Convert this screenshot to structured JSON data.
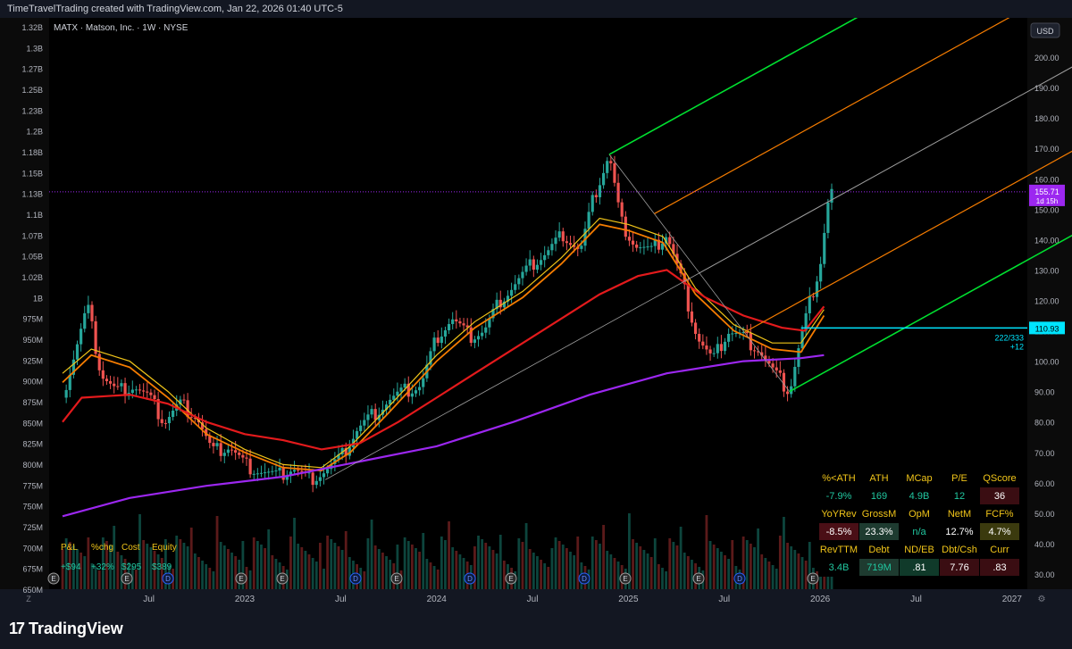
{
  "header": {
    "attribution": "TimeTravelTrading created with TradingView.com, Jan 22, 2026 01:40 UTC-5"
  },
  "footer": {
    "brand": "TradingView",
    "logo_glyph": "17"
  },
  "chart_data": {
    "type": "candlestick",
    "symbol_label": "MATX · Matson, Inc. · 1W · NYSE",
    "currency_button": "USD",
    "price_axis": {
      "range": [
        25,
        210
      ],
      "ticks": [
        "200.00",
        "190.00",
        "180.00",
        "170.00",
        "160.00",
        "150.00",
        "140.00",
        "130.00",
        "120.00",
        "110.00",
        "100.00",
        "90.00",
        "80.00",
        "70.00",
        "60.00",
        "50.00",
        "40.00",
        "30.00"
      ]
    },
    "left_axis": {
      "ticks": [
        "1.32B",
        "1.3B",
        "1.27B",
        "1.25B",
        "1.23B",
        "1.2B",
        "1.18B",
        "1.15B",
        "1.13B",
        "1.1B",
        "1.07B",
        "1.05B",
        "1.02B",
        "1B",
        "975M",
        "950M",
        "925M",
        "900M",
        "875M",
        "850M",
        "825M",
        "800M",
        "775M",
        "750M",
        "725M",
        "700M",
        "675M",
        "650M"
      ]
    },
    "time_axis": {
      "ticks": [
        {
          "label": "Jul",
          "t": 2022.5
        },
        {
          "label": "2023",
          "t": 2023.0
        },
        {
          "label": "Jul",
          "t": 2023.5
        },
        {
          "label": "2024",
          "t": 2024.0
        },
        {
          "label": "Jul",
          "t": 2024.5
        },
        {
          "label": "2025",
          "t": 2025.0
        },
        {
          "label": "Jul",
          "t": 2025.5
        },
        {
          "label": "2026",
          "t": 2026.0
        },
        {
          "label": "Jul",
          "t": 2026.5
        },
        {
          "label": "2027",
          "t": 2027.0
        }
      ]
    },
    "last_price": {
      "value": 155.71,
      "label": "155.71",
      "countdown": "1d 15h",
      "color": "#9c27f0"
    },
    "horizontal_level": {
      "value": 110.93,
      "label": "110.93",
      "note": "222/333",
      "note2": "+12",
      "color": "#00e5ff"
    },
    "price_path": [
      {
        "t": 2022.05,
        "p": 88
      },
      {
        "t": 2022.12,
        "p": 104
      },
      {
        "t": 2022.18,
        "p": 118
      },
      {
        "t": 2022.25,
        "p": 96
      },
      {
        "t": 2022.33,
        "p": 90
      },
      {
        "t": 2022.42,
        "p": 92
      },
      {
        "t": 2022.5,
        "p": 88
      },
      {
        "t": 2022.58,
        "p": 80
      },
      {
        "t": 2022.66,
        "p": 86
      },
      {
        "t": 2022.75,
        "p": 82
      },
      {
        "t": 2022.83,
        "p": 70
      },
      {
        "t": 2022.92,
        "p": 72
      },
      {
        "t": 2023.0,
        "p": 66
      },
      {
        "t": 2023.08,
        "p": 64
      },
      {
        "t": 2023.17,
        "p": 62
      },
      {
        "t": 2023.25,
        "p": 65
      },
      {
        "t": 2023.33,
        "p": 61
      },
      {
        "t": 2023.42,
        "p": 64
      },
      {
        "t": 2023.5,
        "p": 68
      },
      {
        "t": 2023.58,
        "p": 77
      },
      {
        "t": 2023.66,
        "p": 82
      },
      {
        "t": 2023.75,
        "p": 87
      },
      {
        "t": 2023.83,
        "p": 90
      },
      {
        "t": 2023.92,
        "p": 92
      },
      {
        "t": 2024.0,
        "p": 108
      },
      {
        "t": 2024.08,
        "p": 114
      },
      {
        "t": 2024.17,
        "p": 108
      },
      {
        "t": 2024.25,
        "p": 110
      },
      {
        "t": 2024.33,
        "p": 120
      },
      {
        "t": 2024.42,
        "p": 126
      },
      {
        "t": 2024.5,
        "p": 132
      },
      {
        "t": 2024.58,
        "p": 136
      },
      {
        "t": 2024.66,
        "p": 142
      },
      {
        "t": 2024.75,
        "p": 136
      },
      {
        "t": 2024.82,
        "p": 154
      },
      {
        "t": 2024.9,
        "p": 168
      },
      {
        "t": 2024.96,
        "p": 146
      },
      {
        "t": 2025.04,
        "p": 138
      },
      {
        "t": 2025.12,
        "p": 136
      },
      {
        "t": 2025.2,
        "p": 142
      },
      {
        "t": 2025.28,
        "p": 126
      },
      {
        "t": 2025.36,
        "p": 108
      },
      {
        "t": 2025.44,
        "p": 100
      },
      {
        "t": 2025.52,
        "p": 110
      },
      {
        "t": 2025.6,
        "p": 108
      },
      {
        "t": 2025.68,
        "p": 104
      },
      {
        "t": 2025.76,
        "p": 96
      },
      {
        "t": 2025.84,
        "p": 90
      },
      {
        "t": 2025.88,
        "p": 102
      },
      {
        "t": 2025.94,
        "p": 118
      },
      {
        "t": 2026.0,
        "p": 132
      },
      {
        "t": 2026.04,
        "p": 152
      },
      {
        "t": 2026.06,
        "p": 156
      }
    ],
    "moving_averages": [
      {
        "color": "#f57c00",
        "width": 1.8,
        "points": [
          {
            "t": 2022.05,
            "p": 93
          },
          {
            "t": 2022.2,
            "p": 102
          },
          {
            "t": 2022.4,
            "p": 98
          },
          {
            "t": 2022.6,
            "p": 88
          },
          {
            "t": 2022.8,
            "p": 76
          },
          {
            "t": 2023.0,
            "p": 70
          },
          {
            "t": 2023.2,
            "p": 65
          },
          {
            "t": 2023.4,
            "p": 64
          },
          {
            "t": 2023.55,
            "p": 70
          },
          {
            "t": 2023.75,
            "p": 83
          },
          {
            "t": 2024.0,
            "p": 100
          },
          {
            "t": 2024.2,
            "p": 111
          },
          {
            "t": 2024.45,
            "p": 121
          },
          {
            "t": 2024.65,
            "p": 132
          },
          {
            "t": 2024.85,
            "p": 145
          },
          {
            "t": 2025.0,
            "p": 143
          },
          {
            "t": 2025.18,
            "p": 139
          },
          {
            "t": 2025.35,
            "p": 122
          },
          {
            "t": 2025.55,
            "p": 110
          },
          {
            "t": 2025.75,
            "p": 104
          },
          {
            "t": 2025.9,
            "p": 103
          },
          {
            "t": 2026.02,
            "p": 115
          }
        ]
      },
      {
        "color": "#f0c419",
        "width": 1.2,
        "points": [
          {
            "t": 2022.05,
            "p": 96
          },
          {
            "t": 2022.2,
            "p": 104
          },
          {
            "t": 2022.4,
            "p": 100
          },
          {
            "t": 2022.6,
            "p": 90
          },
          {
            "t": 2022.8,
            "p": 78
          },
          {
            "t": 2023.0,
            "p": 71
          },
          {
            "t": 2023.2,
            "p": 66
          },
          {
            "t": 2023.4,
            "p": 65
          },
          {
            "t": 2023.55,
            "p": 72
          },
          {
            "t": 2023.75,
            "p": 85
          },
          {
            "t": 2024.0,
            "p": 102
          },
          {
            "t": 2024.2,
            "p": 113
          },
          {
            "t": 2024.45,
            "p": 123
          },
          {
            "t": 2024.65,
            "p": 134
          },
          {
            "t": 2024.85,
            "p": 147
          },
          {
            "t": 2025.0,
            "p": 145
          },
          {
            "t": 2025.18,
            "p": 141
          },
          {
            "t": 2025.35,
            "p": 124
          },
          {
            "t": 2025.55,
            "p": 112
          },
          {
            "t": 2025.75,
            "p": 106
          },
          {
            "t": 2025.9,
            "p": 106
          },
          {
            "t": 2026.02,
            "p": 117
          }
        ]
      },
      {
        "color": "#e31a1c",
        "width": 2.2,
        "points": [
          {
            "t": 2022.05,
            "p": 80
          },
          {
            "t": 2022.15,
            "p": 88
          },
          {
            "t": 2022.4,
            "p": 89
          },
          {
            "t": 2022.6,
            "p": 86
          },
          {
            "t": 2022.8,
            "p": 80
          },
          {
            "t": 2023.0,
            "p": 76
          },
          {
            "t": 2023.2,
            "p": 74
          },
          {
            "t": 2023.4,
            "p": 71
          },
          {
            "t": 2023.6,
            "p": 73
          },
          {
            "t": 2023.8,
            "p": 80
          },
          {
            "t": 2024.0,
            "p": 88
          },
          {
            "t": 2024.2,
            "p": 96
          },
          {
            "t": 2024.45,
            "p": 106
          },
          {
            "t": 2024.65,
            "p": 114
          },
          {
            "t": 2024.85,
            "p": 122
          },
          {
            "t": 2025.05,
            "p": 128
          },
          {
            "t": 2025.2,
            "p": 130
          },
          {
            "t": 2025.4,
            "p": 121
          },
          {
            "t": 2025.6,
            "p": 115
          },
          {
            "t": 2025.8,
            "p": 111
          },
          {
            "t": 2025.92,
            "p": 110
          },
          {
            "t": 2026.02,
            "p": 118
          }
        ]
      },
      {
        "color": "#9c27f0",
        "width": 2.2,
        "points": [
          {
            "t": 2022.05,
            "p": 49
          },
          {
            "t": 2022.4,
            "p": 55
          },
          {
            "t": 2022.8,
            "p": 59
          },
          {
            "t": 2023.2,
            "p": 62
          },
          {
            "t": 2023.6,
            "p": 67
          },
          {
            "t": 2024.0,
            "p": 72
          },
          {
            "t": 2024.4,
            "p": 80
          },
          {
            "t": 2024.8,
            "p": 89
          },
          {
            "t": 2025.2,
            "p": 96
          },
          {
            "t": 2025.6,
            "p": 100
          },
          {
            "t": 2025.9,
            "p": 101
          },
          {
            "t": 2026.02,
            "p": 102
          }
        ]
      }
    ],
    "pitchfork": {
      "pivot_a": {
        "t": 2023.42,
        "p": 61
      },
      "pivot_b": {
        "t": 2024.9,
        "p": 168
      },
      "pivot_c": {
        "t": 2025.84,
        "p": 90
      }
    },
    "volume_markers": [
      "E",
      "E",
      "D",
      "E",
      "E",
      "D",
      "E",
      "D",
      "E",
      "D",
      "E",
      "E",
      "D",
      "E"
    ],
    "legend_rows": [
      {
        "labels": [
          "P&L",
          "%chg",
          "Cost",
          "Equity"
        ]
      },
      {
        "labels": [
          "+$94",
          "+32%",
          "$295",
          "$389"
        ]
      }
    ],
    "stats_table": {
      "rows": [
        {
          "kind": "header",
          "cells": [
            "%<ATH",
            "ATH",
            "MCap",
            "P/E",
            "QScore"
          ]
        },
        {
          "kind": "value",
          "cells": [
            "-7.9%",
            "169",
            "4.9B",
            "12",
            "36"
          ],
          "bg": [
            "#000000",
            "#000000",
            "#000000",
            "#000000",
            "#3a0d12"
          ],
          "fg": [
            "#21c7a0",
            "#21c7a0",
            "#21c7a0",
            "#21c7a0",
            "#ffffff"
          ]
        },
        {
          "kind": "header",
          "cells": [
            "YoYRev",
            "GrossM",
            "OpM",
            "NetM",
            "FCF%"
          ]
        },
        {
          "kind": "value",
          "cells": [
            "-8.5%",
            "23.3%",
            "n/a",
            "12.7%",
            "4.7%"
          ],
          "bg": [
            "#4a0f16",
            "#1e3b30",
            "#000000",
            "#000000",
            "#3b3a0e"
          ],
          "fg": [
            "#ffffff",
            "#ffffff",
            "#21c7a0",
            "#ffffff",
            "#ffffff"
          ]
        },
        {
          "kind": "header",
          "cells": [
            "RevTTM",
            "Debt",
            "ND/EB",
            "Dbt/Csh",
            "Curr"
          ]
        },
        {
          "kind": "value",
          "cells": [
            "3.4B",
            "719M",
            ".81",
            "7.76",
            ".83"
          ],
          "bg": [
            "#000000",
            "#1e3b30",
            "#103a2a",
            "#3a0d12",
            "#3a0d12"
          ],
          "fg": [
            "#21c7a0",
            "#21c7a0",
            "#ffffff",
            "#ffffff",
            "#ffffff"
          ]
        }
      ]
    }
  }
}
